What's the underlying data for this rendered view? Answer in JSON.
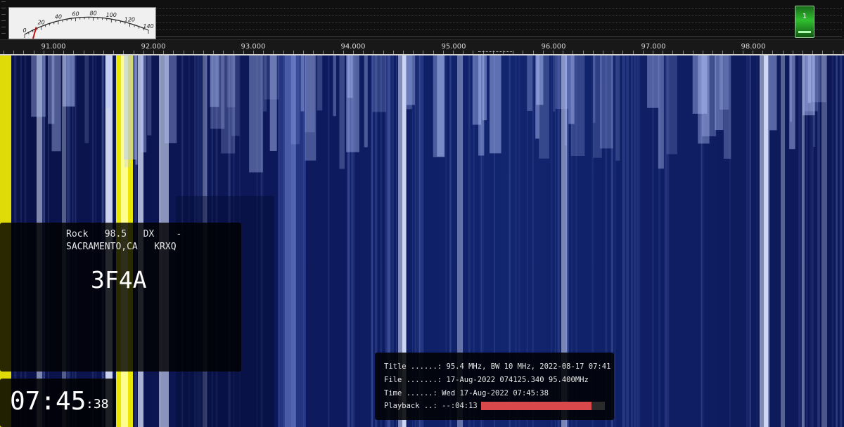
{
  "s_meter": {
    "scale_labels": [
      "0",
      "20",
      "40",
      "60",
      "80",
      "100",
      "120",
      "140"
    ],
    "needle_value": 14
  },
  "agc_indicator": {
    "label": "1"
  },
  "frequency_axis": {
    "labels": [
      "91.000",
      "92.000",
      "93.000",
      "94.000",
      "95.000",
      "96.000",
      "97.000",
      "98.000"
    ]
  },
  "rds": {
    "line1": "Rock   98.5   DX    -",
    "line2": "SACRAMENTO,CA   KRXQ",
    "pi_code": "3F4A"
  },
  "clock": {
    "hours_minutes": "07:45",
    "seconds": ":38"
  },
  "file_info": {
    "title_row": "Title ......: 95.4 MHz, BW 10 MHz, 2022-08-17 07:41",
    "file_row": "File .......: 17-Aug-2022 074125.340 95.400MHz",
    "time_row": "Time ......: Wed 17-Aug-2022 07:45:38",
    "playback_row": "Playback ..: --:04:13",
    "playback_progress": 0.89
  },
  "colors": {
    "waterfall_bg": "#0d1a5e",
    "strong_signal": "#f5f000",
    "playback_fill": "#d9484a",
    "agc_green": "#2fbf2f"
  }
}
